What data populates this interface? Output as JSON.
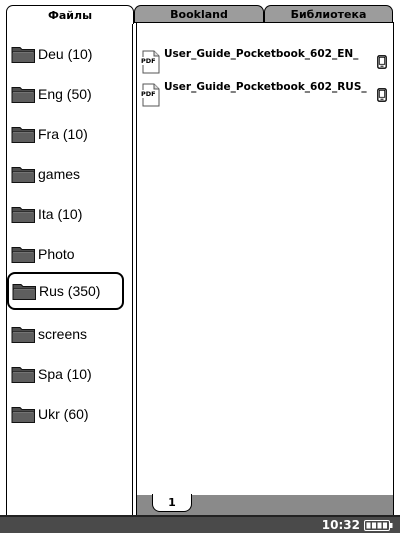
{
  "tabs": [
    {
      "label": "Файлы",
      "active": true
    },
    {
      "label": "Bookland",
      "active": false
    },
    {
      "label": "Библиотека",
      "active": false
    }
  ],
  "folders": [
    {
      "label": "Deu (10)"
    },
    {
      "label": "Eng (50)"
    },
    {
      "label": "Fra (10)"
    },
    {
      "label": "games"
    },
    {
      "label": "Ita (10)"
    },
    {
      "label": "Photo"
    },
    {
      "label": "Rus (350)",
      "selected": true
    },
    {
      "label": "screens"
    },
    {
      "label": "Spa (10)"
    },
    {
      "label": "Ukr (60)"
    }
  ],
  "files": [
    {
      "name": "User_Guide_Pocketbook_602_EN_",
      "type_label": "PDF",
      "location_icon": "device-icon"
    },
    {
      "name": "User_Guide_Pocketbook_602_RUS_",
      "type_label": "PDF",
      "location_icon": "device-icon"
    }
  ],
  "pager": {
    "current_page": "1"
  },
  "status": {
    "time": "10:32",
    "battery_icon": "battery-icon"
  },
  "colors": {
    "inactive_tab": "#9c9c9c",
    "status_bar": "#4a4a4a",
    "pager_bar": "#8a8a8a"
  }
}
